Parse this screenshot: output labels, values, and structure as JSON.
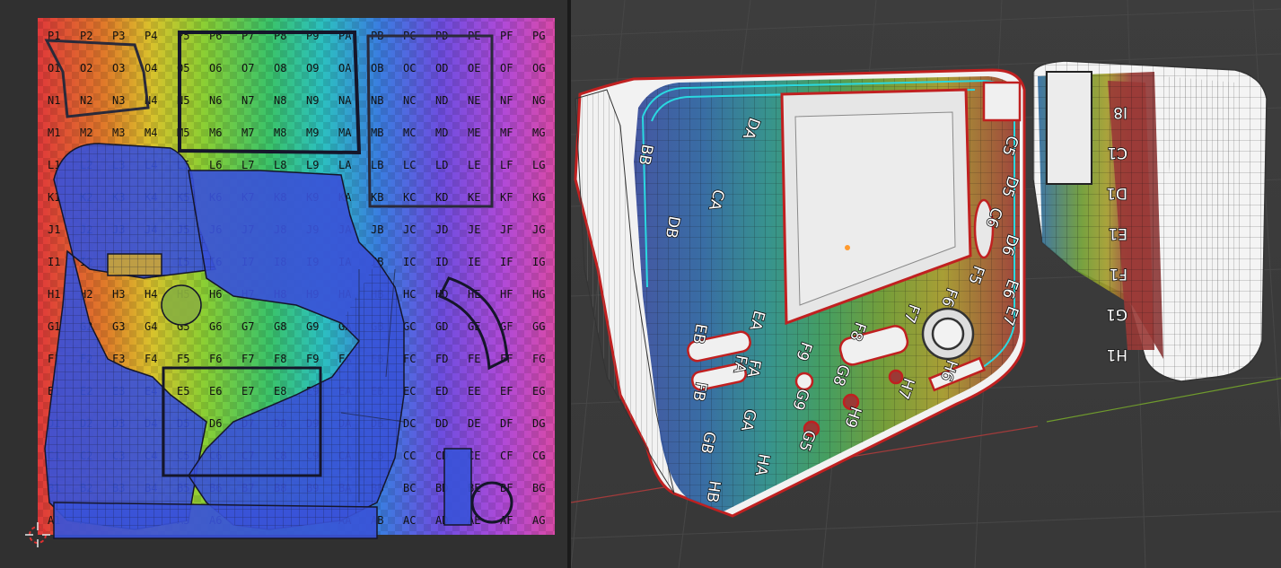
{
  "uv_editor": {
    "row_labels": [
      "P",
      "O",
      "N",
      "M",
      "L",
      "K",
      "J",
      "I",
      "H",
      "G",
      "F",
      "E",
      "D",
      "C",
      "B",
      "A"
    ],
    "col_labels": [
      "1",
      "2",
      "3",
      "4",
      "5",
      "6",
      "7",
      "8",
      "9",
      "A",
      "B",
      "C",
      "D",
      "E",
      "F",
      "G"
    ],
    "colors": {
      "background": "#303030",
      "mesh_fill": "#3a52d8",
      "wire": "#1b1b2a",
      "cursor_red": "#e03030"
    },
    "cursor_icon": "2d-cursor-icon"
  },
  "viewport": {
    "labels": [
      "DA",
      "CA",
      "DB",
      "BB",
      "EA",
      "EB",
      "FA",
      "FB",
      "GA",
      "GB",
      "HA",
      "HB",
      "F9",
      "F8",
      "F7",
      "F6",
      "G9",
      "H9",
      "G8",
      "H7",
      "H6",
      "F5",
      "C5",
      "D5",
      "C6",
      "D6",
      "E6",
      "E7",
      "FA",
      "G5"
    ],
    "right_labels": [
      "I8",
      "C1",
      "D1",
      "E1",
      "F1",
      "G1",
      "H1"
    ],
    "colors": {
      "background": "#3a3a3a",
      "grid_line": "#454545",
      "axis_x": "#a33b3b",
      "axis_y": "#6f9a2d",
      "selection_outline": "#d03030",
      "active_edge": "#2ad8e0",
      "origin_dot": "#ff9a2e"
    }
  }
}
